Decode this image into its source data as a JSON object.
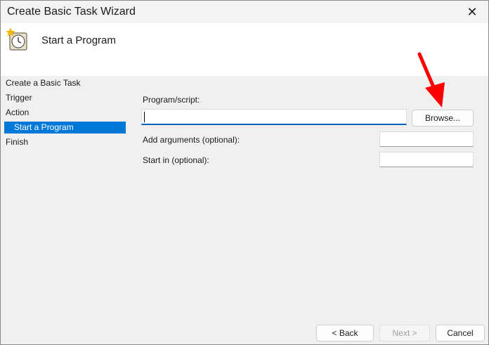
{
  "window": {
    "title": "Create Basic Task Wizard",
    "close_glyph": "✕"
  },
  "header": {
    "icon": "task-scheduler-clock-icon",
    "title": "Start a Program"
  },
  "nav": {
    "items": [
      {
        "label": "Create a Basic Task"
      },
      {
        "label": "Trigger"
      },
      {
        "label": "Action"
      },
      {
        "label": "Start a Program",
        "selected": true
      },
      {
        "label": "Finish"
      }
    ]
  },
  "form": {
    "program_label": "Program/script:",
    "program_value": "",
    "browse_label": "Browse...",
    "arguments_label": "Add arguments (optional):",
    "arguments_value": "",
    "start_in_label": "Start in (optional):",
    "start_in_value": ""
  },
  "footer": {
    "back_label": "< Back",
    "next_label": "Next >",
    "cancel_label": "Cancel"
  },
  "annotation": {
    "arrow_color": "#ff0000"
  },
  "colors": {
    "selection": "#0078d7",
    "focus": "#005fb8"
  }
}
